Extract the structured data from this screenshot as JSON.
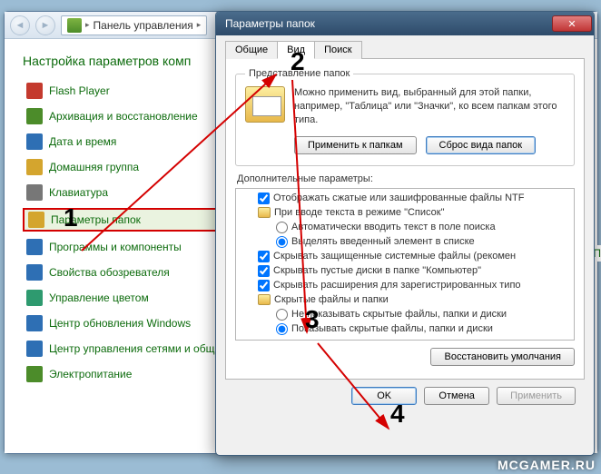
{
  "cp": {
    "address_label": "Панель управления",
    "page_title": "Настройка параметров комп",
    "items": [
      {
        "label": "Flash Player",
        "color": "#c43a2e"
      },
      {
        "label": "Архивация и восстановление",
        "color": "#4c8c2a"
      },
      {
        "label": "Дата и время",
        "color": "#2e6fb4"
      },
      {
        "label": "Домашняя группа",
        "color": "#d4a52e"
      },
      {
        "label": "Клавиатура",
        "color": "#777"
      },
      {
        "label": "Параметры папок",
        "color": "#d4a52e",
        "selected": true
      },
      {
        "label": "Программы и компоненты",
        "color": "#2e6fb4"
      },
      {
        "label": "Свойства обозревателя",
        "color": "#2e6fb4"
      },
      {
        "label": "Управление цветом",
        "color": "#2e9a6f"
      },
      {
        "label": "Центр обновления Windows",
        "color": "#2e6fb4"
      },
      {
        "label": "Центр управления сетями и общи",
        "color": "#2e6fb4"
      },
      {
        "label": "Электропитание",
        "color": "#4c8c2a"
      }
    ]
  },
  "fo": {
    "title": "Параметры папок",
    "tabs": {
      "general": "Общие",
      "view": "Вид",
      "search": "Поиск"
    },
    "folder_view": {
      "legend": "Представление папок",
      "text": "Можно применить вид, выбранный для этой папки, например, \"Таблица\" или \"Значки\", ко всем папкам этого типа.",
      "apply_btn": "Применить к папкам",
      "reset_btn": "Сброс вида папок"
    },
    "adv_label": "Дополнительные параметры:",
    "adv_items": [
      {
        "type": "checkbox",
        "checked": true,
        "indent": 1,
        "text": "Отображать сжатые или зашифрованные файлы NTF"
      },
      {
        "type": "folder",
        "indent": 1,
        "text": "При вводе текста в режиме \"Список\""
      },
      {
        "type": "radio",
        "checked": false,
        "indent": 2,
        "text": "Автоматически вводить текст в поле поиска"
      },
      {
        "type": "radio",
        "checked": true,
        "indent": 2,
        "text": "Выделять введенный элемент в списке"
      },
      {
        "type": "checkbox",
        "checked": true,
        "indent": 1,
        "text": "Скрывать защищенные системные файлы (рекомен"
      },
      {
        "type": "checkbox",
        "checked": true,
        "indent": 1,
        "text": "Скрывать пустые диски в папке \"Компьютер\""
      },
      {
        "type": "checkbox",
        "checked": true,
        "indent": 1,
        "text": "Скрывать расширения для зарегистрированных типо"
      },
      {
        "type": "folder",
        "indent": 1,
        "text": "Скрытые файлы и папки"
      },
      {
        "type": "radio",
        "checked": false,
        "indent": 2,
        "text": "Не показывать скрытые файлы, папки и диски"
      },
      {
        "type": "radio",
        "checked": true,
        "indent": 2,
        "text": "Показывать скрытые файлы, папки и диски"
      }
    ],
    "restore_btn": "Восстановить умолчания",
    "ok": "OK",
    "cancel": "Отмена",
    "apply": "Применить"
  },
  "anno": {
    "n1": "1",
    "n2": "2",
    "n3": "3",
    "n4": "4"
  },
  "watermark": "MCGAMER.RU",
  "edge_text": "\"П"
}
